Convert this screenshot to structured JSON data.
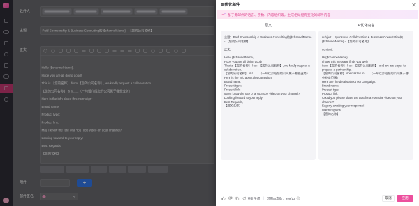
{
  "colors": {
    "accent": "#ec4f9d",
    "banner_text": "#e04a8f",
    "upload_button": "#2f6fdb",
    "sidebar_active": "#b8346b"
  },
  "sidebar": {
    "logo": "logo-icon",
    "items": [
      "dashboard-icon",
      "mail-icon",
      "inbox-icon",
      "contacts-icon",
      "task-icon",
      "chart-icon",
      "send-icon",
      "settings-icon"
    ],
    "active_item": "send-icon"
  },
  "compose": {
    "recipients_label": "收件人",
    "subject_label": "主题",
    "subject_value": "Paid Sponsorship & Business Consulting的{$channelName} - 【您的公司名称】",
    "body_label": "正文",
    "body_lines": [
      "Hello {$channelName},",
      "Hope you are all doing good!",
      "This is 【您的名称】 from 【您的公司名称】, we kindly request a collaboration.",
      "【您的公司名称】 is a ......（一句话介绍您的公司属于哪些业务）",
      "Here is the info about this campaign:",
      "Brand name:",
      "Product type:",
      "Product link:",
      "May I know the rate of a YouTube video on your channel?",
      "Looking forward to your reply!",
      "Best Regards,",
      "【您的名称】"
    ],
    "attachment_label": "附件",
    "signature_label": "邮件签名"
  },
  "drawer": {
    "title": "AI优化邮件",
    "banner_icon": "sparkle-icon",
    "banner_text": "基于源邮件的语言、字数、内容组织等，生成相似但有变化的邮件内容",
    "original": {
      "heading": "原文",
      "lines": [
        "主题：Paid Sponsorship & Business Consulting的{$channelName} - 【您的公司名称】",
        "",
        "正文：",
        "",
        "Hello {$channelName},",
        "Hope you are all doing good!",
        "This is 【您的名称】 from 【您的公司名称】, we kindly request a collaboration.",
        "【您的公司名称】 is a ......（一句话介绍您的公司属于哪些业务）",
        "Here is the info about this campaign:",
        "Brand name:",
        "Product type:",
        "Product link:",
        "May I know the rate of a YouTube video on your channel?",
        "Looking forward to your reply!",
        "Best Regards,",
        "【您的名称】"
      ]
    },
    "optimized": {
      "heading": "AI优化内容",
      "lines": [
        "subject：Sponsored Collaboration & Business Consultation的{$channelName} - 【您的公司名称】",
        "",
        "content：",
        "",
        "Hi {$channelName},",
        "I hope this message finds you well!",
        "I am 【您的名称】 from 【您的公司名称】, and we are eager to propose a partnership.",
        "【您的公司名称】 specializes in ......（一句话介绍您的公司属于哪些业务范围）",
        "Here are the details about our campaign:",
        "Brand name:",
        "Product type:",
        "Product link:",
        "Could you please share the cost for a YouTube video on your channel?",
        "Eagerly awaiting your response!",
        "Warm regards,",
        "【您的名称】"
      ]
    },
    "footer": {
      "icons": [
        "like-icon",
        "dislike-icon",
        "copy-icon",
        "refresh-icon",
        "info-icon"
      ],
      "regenerate_label": "重新生成",
      "quota_text": "可用AI次数：999/13",
      "cancel_label": "取消",
      "apply_label": "应用"
    }
  }
}
